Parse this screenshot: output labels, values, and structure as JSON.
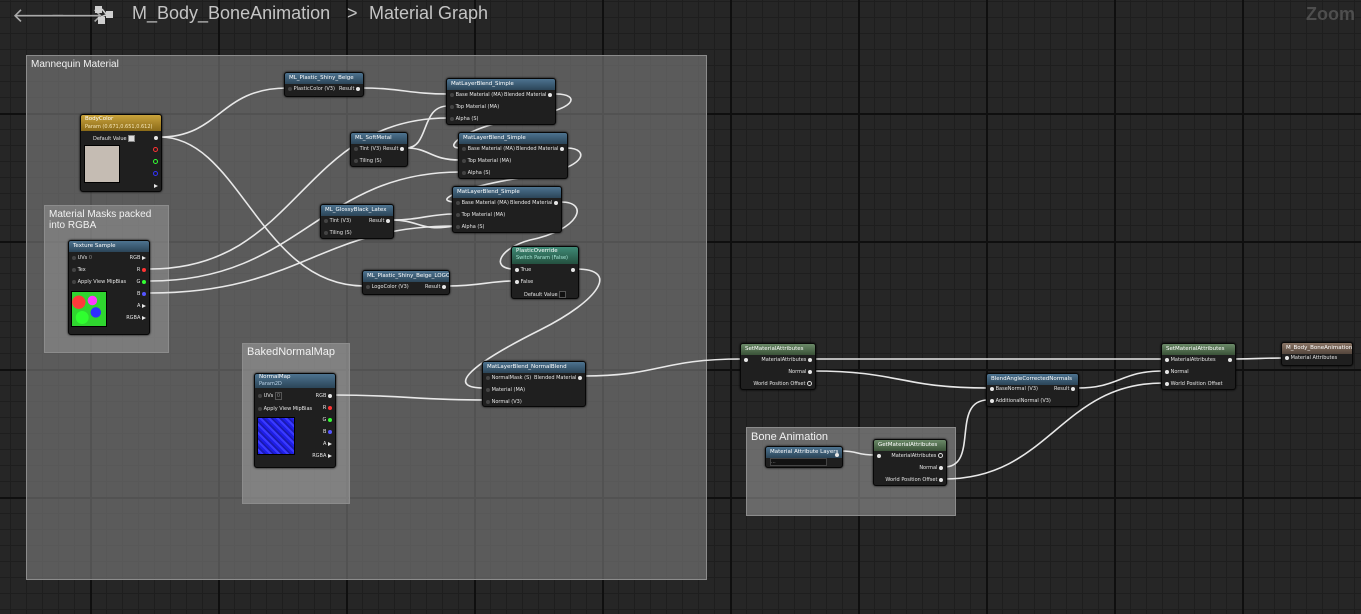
{
  "toolbar": {
    "back_glyph": "🡐",
    "forward_glyph": "🡒",
    "asset_name": "M_Body_BoneAnimation",
    "separator": ">",
    "graph_name": "Material Graph",
    "zoom_label": "Zoom"
  },
  "comments": {
    "mannequin": "Mannequin Material",
    "masks": "Material Masks packed into RGBA",
    "baked": "BakedNormalMap",
    "bone": "Bone Animation"
  },
  "nodes": {
    "body_color": {
      "title": "BodyColor",
      "subtitle": "Param (0.671,0.651,0.612)",
      "pin": "Default Value"
    },
    "texture_sample": {
      "title": "Texture Sample",
      "pins_in": [
        "UVs",
        "Tex",
        "Apply View MipBias"
      ],
      "uvs_value": "0",
      "pins_out": [
        "RGB",
        "R",
        "G",
        "B",
        "A",
        "RGBA"
      ]
    },
    "plastic_shiny_beige": {
      "title": "ML_Plastic_Shiny_Beige",
      "in": "PlasticColor (V3)",
      "out": "Result"
    },
    "soft_metal": {
      "title": "ML_SoftMetal",
      "in": [
        "Tint (V3)",
        "Tiling (S)"
      ],
      "out": "Result"
    },
    "glossy_black_latex": {
      "title": "ML_GlossyBlack_Latex",
      "in": [
        "Tint (V3)",
        "Tiling (S)"
      ],
      "out": "Result"
    },
    "plastic_shiny_beige_logo": {
      "title": "ML_Plastic_Shiny_Beige_LOGO",
      "in": "LogoColor (V3)",
      "out": "Result"
    },
    "blend1": {
      "title": "MatLayerBlend_Simple",
      "in": [
        "Base Material (MA)",
        "Top Material (MA)",
        "Alpha (S)"
      ],
      "out": "Blended Material"
    },
    "blend2": {
      "title": "MatLayerBlend_Simple",
      "in": [
        "Base Material (MA)",
        "Top Material (MA)",
        "Alpha (S)"
      ],
      "out": "Blended Material"
    },
    "blend3": {
      "title": "MatLayerBlend_Simple",
      "in": [
        "Base Material (MA)",
        "Top Material (MA)",
        "Alpha (S)"
      ],
      "out": "Blended Material"
    },
    "plastic_override": {
      "title": "PlasticOverride",
      "subtitle": "Switch Param (False)",
      "in": [
        "True",
        "False",
        "Default Value"
      ]
    },
    "normal_map": {
      "title": "NormalMap",
      "subtitle": "Param2D",
      "pins_in": [
        "UVs",
        "Apply View MipBias"
      ],
      "uvs_value": "0",
      "pins_out": [
        "RGB",
        "R",
        "G",
        "B",
        "A",
        "RGBA"
      ]
    },
    "blend_normal": {
      "title": "MatLayerBlend_NormalBlend",
      "in": [
        "NormalMask (S)",
        "Material (MA)",
        "Normal (V3)"
      ],
      "out": "Blended Material"
    },
    "set_attr1": {
      "title": "SetMaterialAttributes",
      "in": [
        "MaterialAttributes",
        "Normal",
        "World Position Offset"
      ]
    },
    "mat_attr_layers": {
      "title": "Material Attribute Layers",
      "value": "..."
    },
    "get_attr": {
      "title": "GetMaterialAttributes",
      "out": [
        "MaterialAttributes",
        "Normal",
        "World Position Offset"
      ]
    },
    "blend_angle": {
      "title": "BlendAngleCorrectedNormals",
      "in": [
        "BaseNormal (V3)",
        "AdditionalNormal (V3)"
      ],
      "out": "Result"
    },
    "set_attr2": {
      "title": "SetMaterialAttributes",
      "in": [
        "MaterialAttributes",
        "Normal",
        "World Position Offset"
      ]
    },
    "output": {
      "title": "M_Body_BoneAnimation",
      "in": "Material Attributes"
    }
  }
}
